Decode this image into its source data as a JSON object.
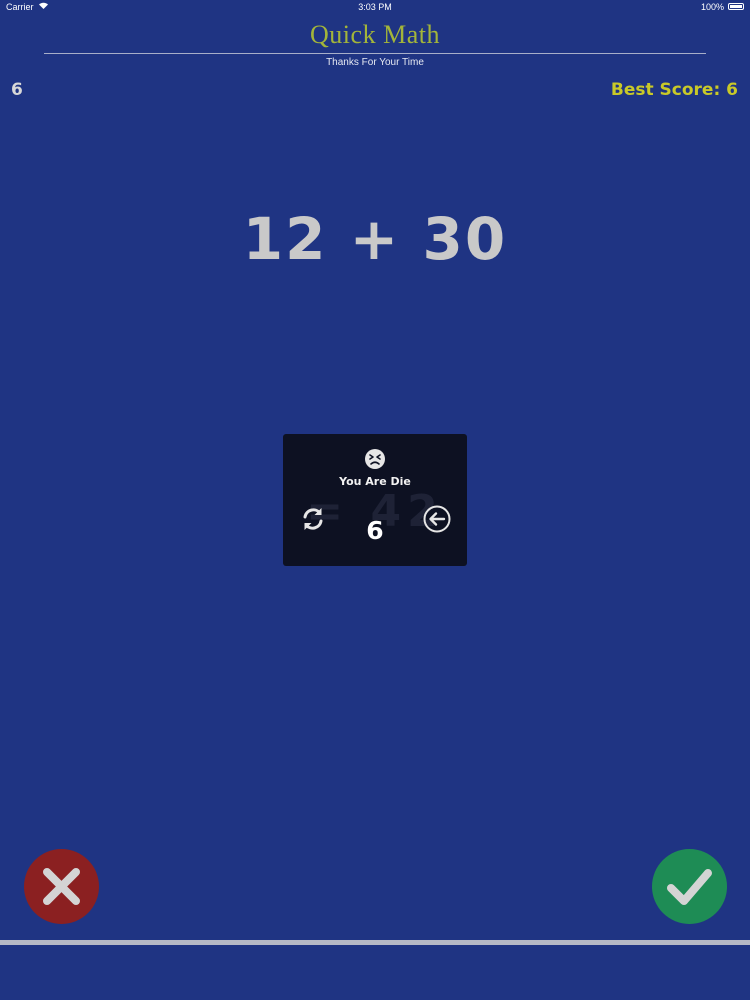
{
  "status_bar": {
    "carrier": "Carrier",
    "time": "3:03 PM",
    "battery": "100%"
  },
  "header": {
    "title": "Quick Math",
    "subtitle": "Thanks For Your Time"
  },
  "scores": {
    "current": "6",
    "best": "Best Score: 6"
  },
  "question": {
    "text": "12 + 30"
  },
  "dialog": {
    "icon": "sad-face-icon",
    "message": "You Are Die",
    "score": "6",
    "faded_text": "= 42",
    "restart_icon": "restart-icon",
    "back_icon": "back-arrow-icon"
  },
  "buttons": {
    "wrong_icon": "x-icon",
    "right_icon": "checkmark-icon"
  },
  "colors": {
    "background": "#1f3483",
    "title": "#a3b53a",
    "best_score": "#c9c928",
    "wrong": "#8b2021",
    "right": "#1e8c55",
    "dialog": "#0d1122"
  }
}
